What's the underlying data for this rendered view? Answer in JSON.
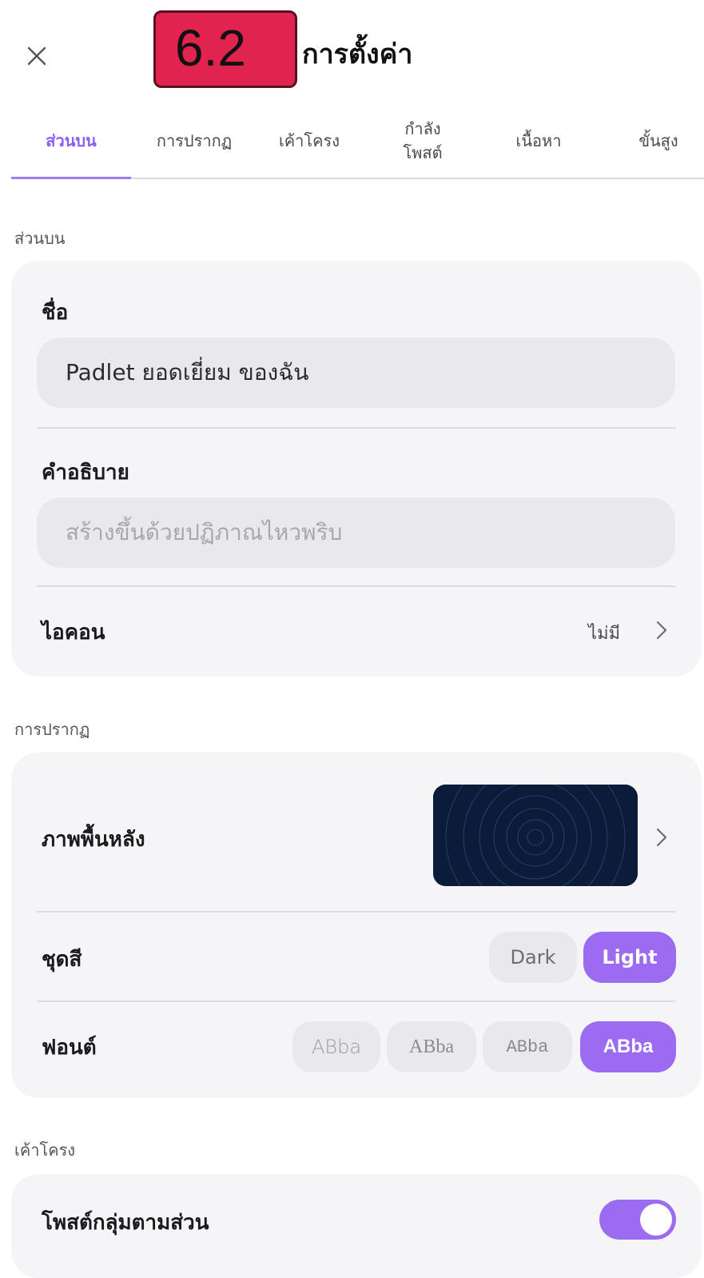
{
  "annotation": {
    "step_badge": "6.2"
  },
  "header": {
    "title": "การตั้งค่า",
    "close_icon": "close-icon"
  },
  "tabs": [
    {
      "label": "ส่วนบน",
      "active": true
    },
    {
      "label": "การปรากฏ",
      "active": false
    },
    {
      "label": "เค้าโครง",
      "active": false
    },
    {
      "label": "กำลัง\nโพสต์",
      "active": false
    },
    {
      "label": "เนื้อหา",
      "active": false
    },
    {
      "label": "ขั้นสูง",
      "active": false
    }
  ],
  "sections": {
    "header_section": {
      "label": "ส่วนบน",
      "title_field": {
        "label": "ชื่อ",
        "value": "Padlet ยอดเยี่ยม ของฉัน"
      },
      "description_field": {
        "label": "คำอธิบาย",
        "placeholder": "สร้างขึ้นด้วยปฏิภาณไหวพริบ"
      },
      "icon_row": {
        "label": "ไอคอน",
        "value": "ไม่มี",
        "chevron_icon": "chevron-right-icon"
      }
    },
    "appearance_section": {
      "label": "การปรากฏ",
      "wallpaper_row": {
        "label": "ภาพพื้นหลัง",
        "chevron_icon": "chevron-right-icon"
      },
      "color_scheme_row": {
        "label": "ชุดสี",
        "options": [
          "Dark",
          "Light"
        ],
        "selected": "Light"
      },
      "font_row": {
        "label": "ฟอนต์",
        "options": [
          "ABba",
          "ABba",
          "ABba",
          "ABba"
        ],
        "selected_index": 3
      }
    },
    "layout_section": {
      "label": "เค้าโครง",
      "group_by_section_row": {
        "label": "โพสต์กลุ่มตามส่วน",
        "toggle_on": true
      }
    }
  },
  "colors": {
    "accent": "#9b6bf0",
    "badge": "#e0234f",
    "card_bg": "#f5f5f7",
    "wallpaper": "#0b1b3a"
  }
}
